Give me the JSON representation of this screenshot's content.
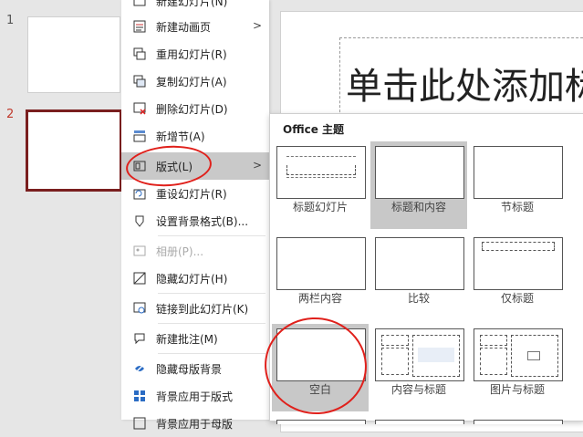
{
  "thumbnails": [
    {
      "number": "1"
    },
    {
      "number": "2"
    }
  ],
  "slide": {
    "title_placeholder": "单击此处添加标"
  },
  "context_menu": {
    "items": [
      {
        "label": "新建幻灯片(N)",
        "icon": "new-slide-icon"
      },
      {
        "label": "新建动画页",
        "icon": "new-animation-page-icon",
        "submenu": true
      },
      {
        "label": "重用幻灯片(R)",
        "icon": "reuse-slides-icon"
      },
      {
        "label": "复制幻灯片(A)",
        "icon": "duplicate-slide-icon"
      },
      {
        "label": "删除幻灯片(D)",
        "icon": "delete-slide-icon"
      },
      {
        "label": "新增节(A)",
        "icon": "add-section-icon"
      },
      {
        "label": "版式(L)",
        "icon": "layout-icon",
        "submenu": true,
        "highlighted": true
      },
      {
        "label": "重设幻灯片(R)",
        "icon": "reset-slide-icon"
      },
      {
        "label": "设置背景格式(B)...",
        "icon": "format-background-icon"
      },
      {
        "label": "相册(P)...",
        "icon": "photo-album-icon",
        "disabled": true
      },
      {
        "label": "隐藏幻灯片(H)",
        "icon": "hide-slide-icon"
      },
      {
        "label": "链接到此幻灯片(K)",
        "icon": "link-to-slide-icon"
      },
      {
        "label": "新建批注(M)",
        "icon": "new-comment-icon"
      },
      {
        "label": "隐藏母版背景",
        "icon": "hide-master-background-icon"
      },
      {
        "label": "背景应用于版式",
        "icon": "apply-background-icon"
      },
      {
        "label": "背景应用于母版",
        "icon": "apply-background-master-icon"
      }
    ]
  },
  "layout_gallery": {
    "title": "Office 主题",
    "layouts": [
      {
        "name": "标题幻灯片",
        "kind": "title"
      },
      {
        "name": "标题和内容",
        "kind": "title-content",
        "selected": true
      },
      {
        "name": "节标题",
        "kind": "section"
      },
      {
        "name": "两栏内容",
        "kind": "two-content"
      },
      {
        "name": "比较",
        "kind": "comparison"
      },
      {
        "name": "仅标题",
        "kind": "title-only"
      },
      {
        "name": "空白",
        "kind": "blank"
      },
      {
        "name": "内容与标题",
        "kind": "content-caption"
      },
      {
        "name": "图片与标题",
        "kind": "picture-caption"
      }
    ]
  },
  "colors": {
    "annotation": "#e0201b",
    "selected_slide_border": "#7a1f1f",
    "active_slide_number": "#c0392b"
  }
}
